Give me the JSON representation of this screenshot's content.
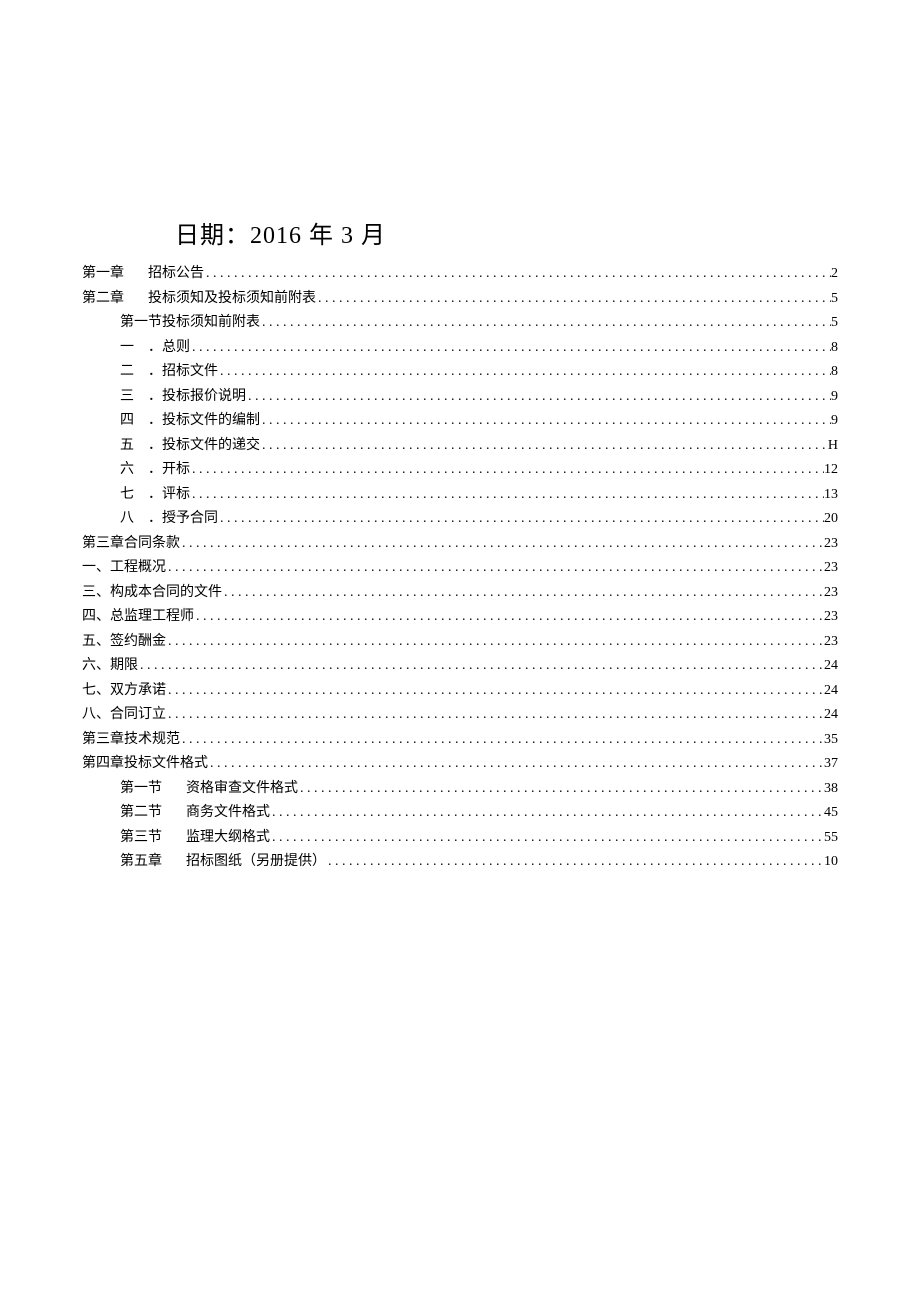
{
  "title": "日期：2016 年 3 月",
  "toc": [
    {
      "indent": 0,
      "prefix": "第一章",
      "gap": true,
      "text": "招标公告",
      "page": "2"
    },
    {
      "indent": 0,
      "prefix": "第二章",
      "gap": true,
      "text": "投标须知及投标须知前附表",
      "page": "5"
    },
    {
      "indent": 1,
      "prefix": "",
      "gap": false,
      "text": "第一节投标须知前附表",
      "page": "5"
    },
    {
      "indent": 2,
      "prefix": "一",
      "gap": false,
      "subgap": true,
      "text": "．总则",
      "page": "8"
    },
    {
      "indent": 2,
      "prefix": "二",
      "gap": false,
      "subgap": true,
      "text": "．招标文件",
      "page": "8"
    },
    {
      "indent": 2,
      "prefix": "三",
      "gap": false,
      "subgap": true,
      "text": "．投标报价说明",
      "page": "9"
    },
    {
      "indent": 2,
      "prefix": "四",
      "gap": false,
      "subgap": true,
      "text": "．投标文件的编制",
      "page": "9"
    },
    {
      "indent": 2,
      "prefix": "五",
      "gap": false,
      "subgap": true,
      "text": "．投标文件的递交",
      "page": "H"
    },
    {
      "indent": 2,
      "prefix": "六",
      "gap": false,
      "subgap": true,
      "text": "．开标",
      "page": "12"
    },
    {
      "indent": 2,
      "prefix": "七",
      "gap": false,
      "subgap": true,
      "text": "．评标",
      "page": "13"
    },
    {
      "indent": 2,
      "prefix": "八",
      "gap": false,
      "subgap": true,
      "text": "．授予合同",
      "page": "20"
    },
    {
      "indent": 0,
      "prefix": "",
      "gap": false,
      "text": "第三章合同条款",
      "page": "23"
    },
    {
      "indent": 0,
      "prefix": "",
      "gap": false,
      "text": "一、工程概况",
      "page": "23"
    },
    {
      "indent": 0,
      "prefix": "",
      "gap": false,
      "text": "三、构成本合同的文件",
      "page": "23"
    },
    {
      "indent": 0,
      "prefix": "",
      "gap": false,
      "text": "四、总监理工程师",
      "page": "23"
    },
    {
      "indent": 0,
      "prefix": "",
      "gap": false,
      "text": "五、签约酬金",
      "page": "23"
    },
    {
      "indent": 0,
      "prefix": "",
      "gap": false,
      "text": "六、期限",
      "page": "24"
    },
    {
      "indent": 0,
      "prefix": "",
      "gap": false,
      "text": "七、双方承诺",
      "page": "24"
    },
    {
      "indent": 0,
      "prefix": "",
      "gap": false,
      "text": "八、合同订立",
      "page": "24"
    },
    {
      "indent": 0,
      "prefix": "",
      "gap": false,
      "text": "第三章技术规范",
      "page": "35"
    },
    {
      "indent": 0,
      "prefix": "",
      "gap": false,
      "text": "第四章投标文件格式",
      "page": "37"
    },
    {
      "indent": 1,
      "prefix": "第一节",
      "gap": true,
      "text": "资格审查文件格式",
      "page": "38"
    },
    {
      "indent": 1,
      "prefix": "第二节",
      "gap": true,
      "text": "商务文件格式",
      "page": "45"
    },
    {
      "indent": 1,
      "prefix": "第三节",
      "gap": true,
      "text": "监理大纲格式",
      "page": "55"
    },
    {
      "indent": 1,
      "prefix": "第五章",
      "gap": true,
      "text": "招标图纸（另册提供）",
      "page": "10"
    }
  ]
}
